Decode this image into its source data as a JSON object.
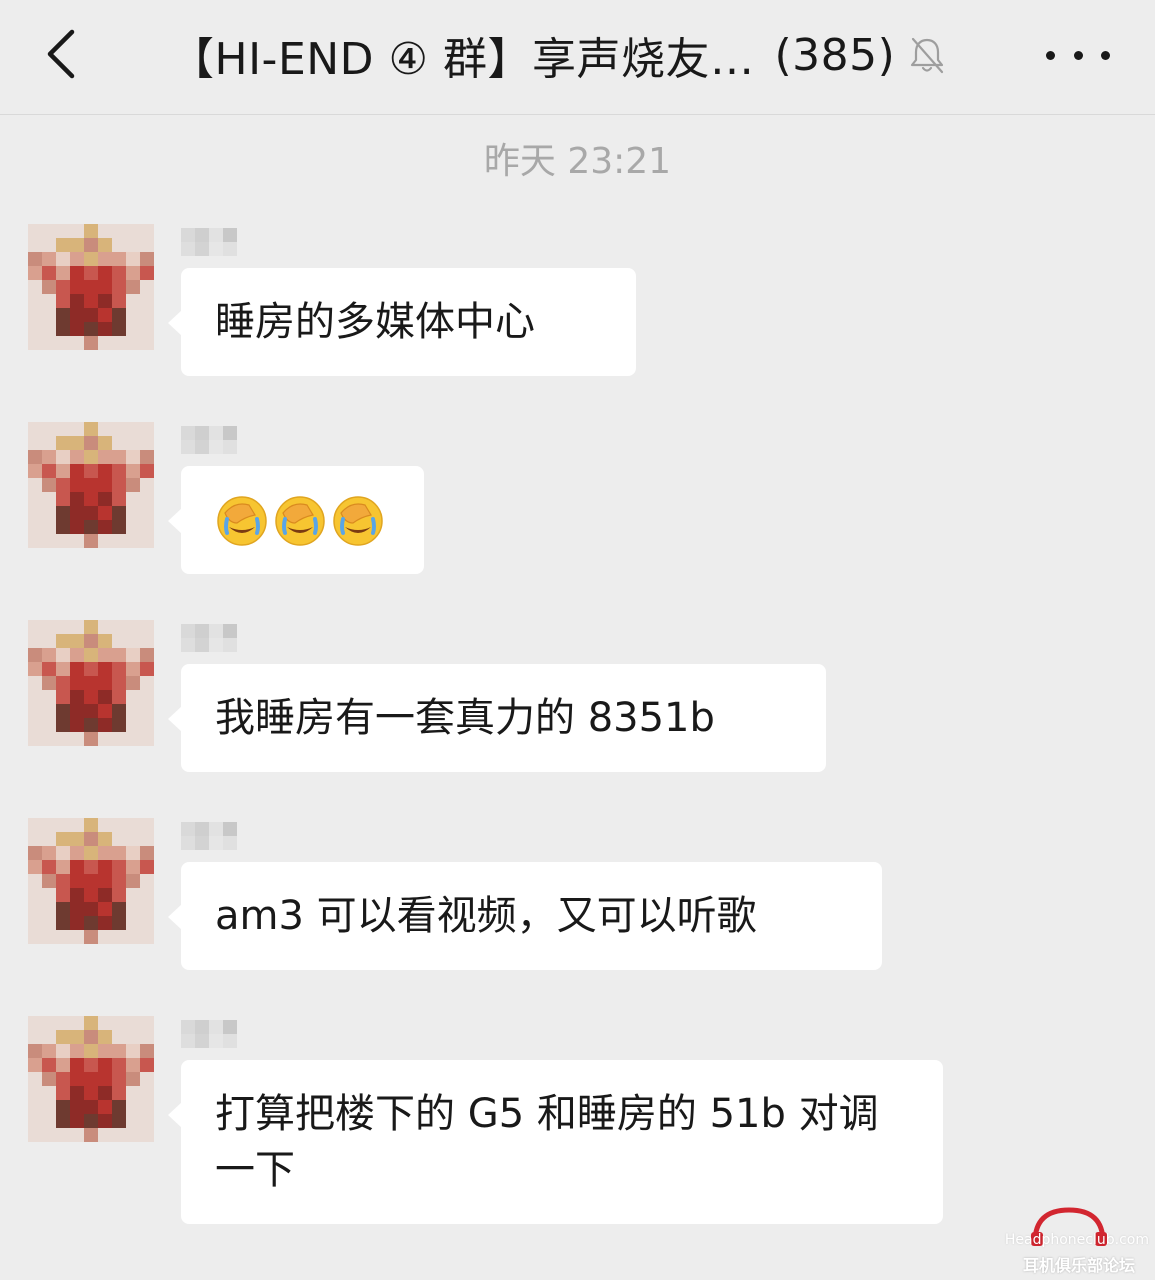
{
  "header": {
    "title": "【HI-END ④ 群】享声烧友…",
    "member_count": "(385)",
    "back_icon": "chevron-left-icon",
    "mute_icon": "bell-muted-icon",
    "more_icon": "more-dots-icon"
  },
  "chat": {
    "timestamp": "昨天 23:21",
    "messages": [
      {
        "type": "text",
        "text": "睡房的多媒体中心"
      },
      {
        "type": "emoji",
        "emojis": [
          "facepalm-crying-emoji",
          "facepalm-crying-emoji",
          "facepalm-crying-emoji"
        ]
      },
      {
        "type": "text",
        "text": "我睡房有一套真力的 8351b"
      },
      {
        "type": "text",
        "text": "am3 可以看视频，又可以听歌"
      },
      {
        "type": "text",
        "text": "打算把楼下的 G5 和睡房的 51b 对调一下"
      }
    ]
  },
  "watermark": {
    "line1": "Headphoneclub.com",
    "line2": "耳机俱乐部论坛"
  },
  "colors": {
    "background": "#ededed",
    "bubble": "#ffffff",
    "text": "#191919",
    "timestamp": "#a8a8a8",
    "watermark_accent": "#d22630"
  }
}
